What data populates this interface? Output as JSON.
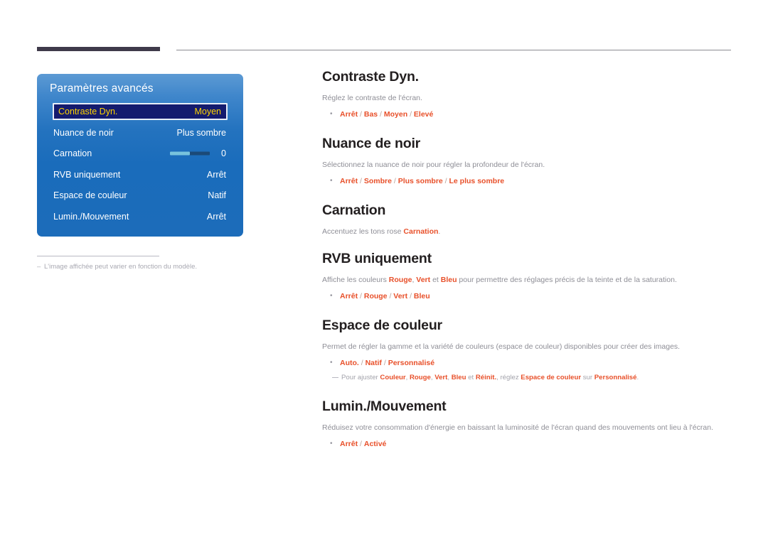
{
  "page": {
    "language": "fr",
    "accent_color": "#e8502a",
    "heading_color": "#231f20",
    "body_color": "#8e8e96",
    "osd_panel_blue": "#1c6cba",
    "osd_selected_fill": "#141b6e",
    "osd_selected_text": "#ffd400"
  },
  "osd": {
    "title": "Paramètres avancés",
    "rows": [
      {
        "label": "Contraste Dyn.",
        "value": "Moyen",
        "selected": true,
        "type": "value"
      },
      {
        "label": "Nuance de noir",
        "value": "Plus sombre",
        "selected": false,
        "type": "value"
      },
      {
        "label": "Carnation",
        "value": "0",
        "selected": false,
        "type": "slider",
        "slider_percent": 50
      },
      {
        "label": "RVB uniquement",
        "value": "Arrêt",
        "selected": false,
        "type": "value"
      },
      {
        "label": "Espace de couleur",
        "value": "Natif",
        "selected": false,
        "type": "value"
      },
      {
        "label": "Lumin./Mouvement",
        "value": "Arrêt",
        "selected": false,
        "type": "value"
      }
    ],
    "footnote": "L'image affichée peut varier en fonction du modèle.",
    "footnote_dash": "‒"
  },
  "doc": {
    "sections": [
      {
        "heading": "Contraste Dyn.",
        "description": "Réglez le contraste de l'écran.",
        "options": [
          "Arrêt",
          "Bas",
          "Moyen",
          "Elevé"
        ]
      },
      {
        "heading": "Nuance de noir",
        "description": "Sélectionnez la nuance de noir pour régler la profondeur de l'écran.",
        "options": [
          "Arrêt",
          "Sombre",
          "Plus sombre",
          "Le plus sombre"
        ]
      },
      {
        "heading": "Carnation",
        "description_parts": [
          {
            "text": "Accentuez les tons rose ",
            "accent": false
          },
          {
            "text": "Carnation",
            "accent": true
          },
          {
            "text": ".",
            "accent": false
          }
        ],
        "options": []
      },
      {
        "heading": "RVB uniquement",
        "description_parts": [
          {
            "text": "Affiche les couleurs ",
            "accent": false
          },
          {
            "text": "Rouge",
            "accent": true
          },
          {
            "text": ", ",
            "accent": false
          },
          {
            "text": "Vert",
            "accent": true
          },
          {
            "text": " et ",
            "accent": false
          },
          {
            "text": "Bleu",
            "accent": true
          },
          {
            "text": " pour permettre des réglages précis de la teinte et de la saturation.",
            "accent": false
          }
        ],
        "options": [
          "Arrêt",
          "Rouge",
          "Vert",
          "Bleu"
        ]
      },
      {
        "heading": "Espace de couleur",
        "description": "Permet de régler la gamme et la variété de couleurs (espace de couleur) disponibles pour créer des images.",
        "options": [
          "Auto.",
          "Natif",
          "Personnalisé"
        ],
        "subnote_parts": [
          {
            "text": "Pour ajuster ",
            "accent": false
          },
          {
            "text": "Couleur",
            "accent": true
          },
          {
            "text": ", ",
            "accent": false
          },
          {
            "text": "Rouge",
            "accent": true
          },
          {
            "text": ", ",
            "accent": false
          },
          {
            "text": "Vert",
            "accent": true
          },
          {
            "text": ", ",
            "accent": false
          },
          {
            "text": "Bleu",
            "accent": true
          },
          {
            "text": " et ",
            "accent": false
          },
          {
            "text": "Réinit.",
            "accent": true
          },
          {
            "text": ", réglez ",
            "accent": false
          },
          {
            "text": "Espace de couleur",
            "accent": true
          },
          {
            "text": " sur ",
            "accent": false
          },
          {
            "text": "Personnalisé",
            "accent": true
          },
          {
            "text": ".",
            "accent": false
          }
        ]
      },
      {
        "heading": "Lumin./Mouvement",
        "description": "Réduisez votre consommation d'énergie en baissant la luminosité de l'écran quand des mouvements ont lieu à l'écran.",
        "options": [
          "Arrêt",
          "Activé"
        ]
      }
    ],
    "option_separator": "/"
  }
}
